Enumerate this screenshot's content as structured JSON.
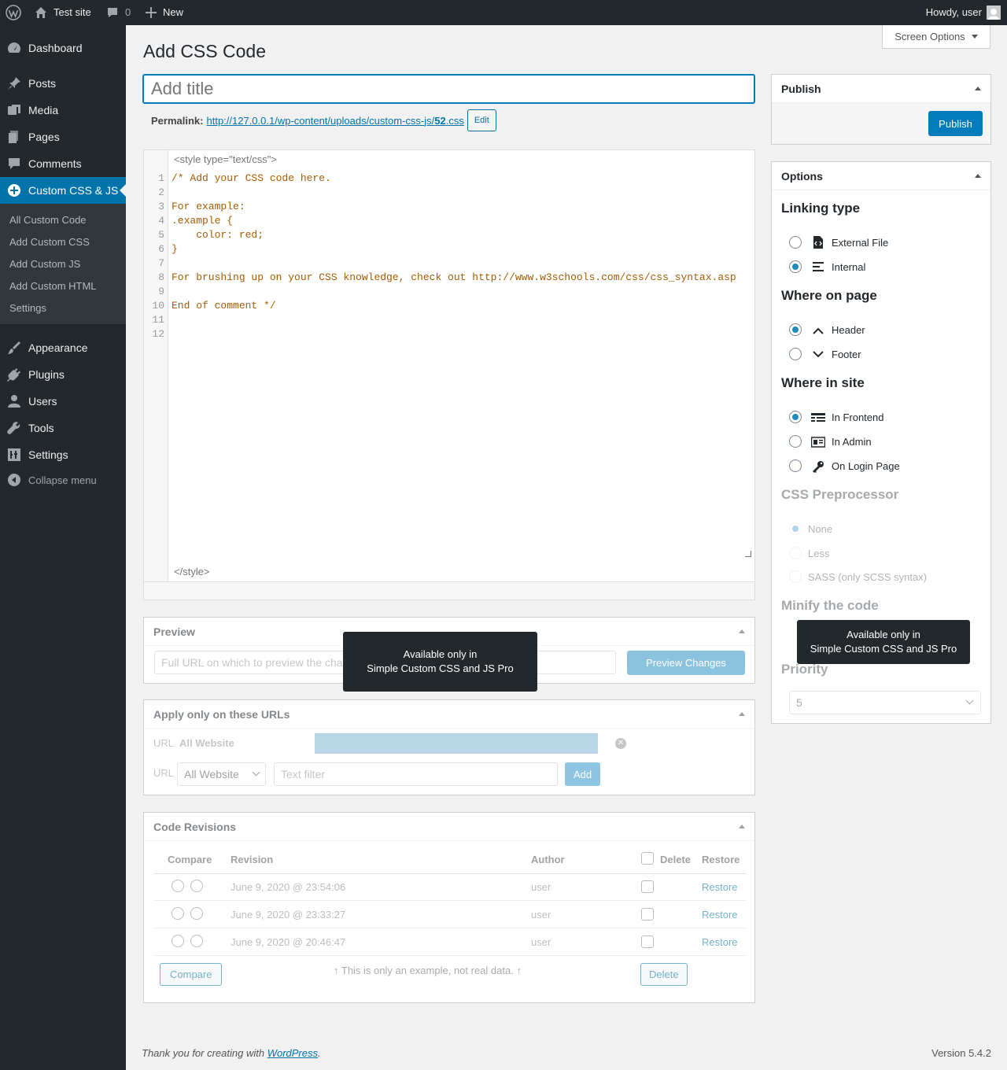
{
  "adminbar": {
    "site_name": "Test site",
    "comments_count": "0",
    "new_label": "New",
    "greeting": "Howdy, user"
  },
  "sidebar": {
    "items": [
      {
        "label": "Dashboard",
        "icon": "dashboard-icon"
      },
      {
        "label": "Posts",
        "icon": "pin-icon"
      },
      {
        "label": "Media",
        "icon": "media-icon"
      },
      {
        "label": "Pages",
        "icon": "pages-icon"
      },
      {
        "label": "Comments",
        "icon": "comment-icon"
      },
      {
        "label": "Custom CSS & JS",
        "icon": "plus-circle-icon"
      },
      {
        "label": "Appearance",
        "icon": "brush-icon"
      },
      {
        "label": "Plugins",
        "icon": "plug-icon"
      },
      {
        "label": "Users",
        "icon": "user-icon"
      },
      {
        "label": "Tools",
        "icon": "wrench-icon"
      },
      {
        "label": "Settings",
        "icon": "settings-icon"
      }
    ],
    "submenu": [
      "All Custom Code",
      "Add Custom CSS",
      "Add Custom JS",
      "Add Custom HTML",
      "Settings"
    ],
    "collapse": "Collapse menu"
  },
  "page": {
    "title": "Add CSS Code",
    "screen_options": "Screen Options",
    "title_placeholder": "Add title",
    "permalink_label": "Permalink:",
    "permalink_url": "http://127.0.0.1/wp-content/uploads/custom-css-js/",
    "permalink_slug": "52",
    "permalink_ext": ".css",
    "edit_label": "Edit"
  },
  "editor": {
    "open_tag": "<style type=\"text/css\">",
    "close_tag": "</style>",
    "lines": [
      "/* Add your CSS code here.",
      "",
      "For example:",
      ".example {",
      "    color: red;",
      "}",
      "",
      "For brushing up on your CSS knowledge, check out http://www.w3schools.com/css/css_syntax.asp",
      "",
      "End of comment */",
      "",
      ""
    ]
  },
  "preview": {
    "title": "Preview",
    "placeholder": "Full URL on which to preview the cha",
    "button": "Preview Changes"
  },
  "tooltip": {
    "line1": "Available only in",
    "line2": "Simple Custom CSS and JS Pro"
  },
  "urls": {
    "title": "Apply only on these URLs",
    "row_label": "URL",
    "row_value": "All Website",
    "select_value": "All Website",
    "filter_placeholder": "Text filter",
    "add": "Add"
  },
  "revisions": {
    "title": "Code Revisions",
    "headers": {
      "compare": "Compare",
      "revision": "Revision",
      "author": "Author",
      "delete": "Delete",
      "restore": "Restore"
    },
    "rows": [
      {
        "date": "June 9, 2020 @ 23:54:06",
        "author": "user",
        "restore": "Restore"
      },
      {
        "date": "June 9, 2020 @ 23:33:27",
        "author": "user",
        "restore": "Restore"
      },
      {
        "date": "June 9, 2020 @ 20:46:47",
        "author": "user",
        "restore": "Restore"
      }
    ],
    "compare_btn": "Compare",
    "note": "↑ This is only an example, not real data. ↑",
    "delete_btn": "Delete"
  },
  "publish": {
    "title": "Publish",
    "button": "Publish"
  },
  "options": {
    "title": "Options",
    "linking_title": "Linking type",
    "linking": [
      {
        "label": "External File",
        "selected": false
      },
      {
        "label": "Internal",
        "selected": true
      }
    ],
    "where_page_title": "Where on page",
    "where_page": [
      {
        "label": "Header",
        "selected": true
      },
      {
        "label": "Footer",
        "selected": false
      }
    ],
    "where_site_title": "Where in site",
    "where_site": [
      {
        "label": "In Frontend",
        "selected": true
      },
      {
        "label": "In Admin",
        "selected": false
      },
      {
        "label": "On Login Page",
        "selected": false
      }
    ],
    "preproc_title": "CSS Preprocessor",
    "preproc": [
      "None",
      "Less",
      "SASS (only SCSS syntax)"
    ],
    "minify_title": "Minify the code",
    "priority_title": "Priority",
    "priority_value": "5"
  },
  "footer": {
    "thanks_prefix": "Thank you for creating with ",
    "thanks_link": "WordPress",
    "thanks_suffix": ".",
    "version": "Version 5.4.2"
  }
}
